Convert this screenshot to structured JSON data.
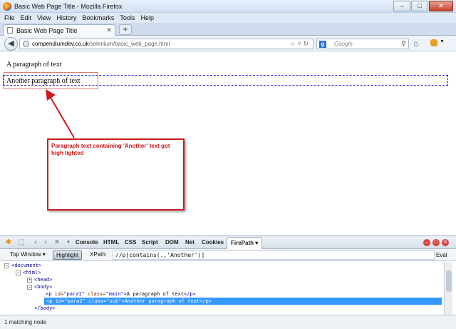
{
  "window": {
    "title": "Basic Web Page Title - Mozilla Firefox",
    "buttons": [
      "–",
      "□",
      "✕"
    ]
  },
  "menubar": {
    "items": [
      "File",
      "Edit",
      "View",
      "History",
      "Bookmarks",
      "Tools",
      "Help"
    ]
  },
  "tabs": {
    "active_title": "Basic Web Page Title",
    "new_tab": "+"
  },
  "navbar": {
    "url_host": "compendiumdev.co.uk",
    "url_path": "/selenium/basic_web_page.html",
    "search_placeholder": "Google",
    "search_engine_letter": "g"
  },
  "page": {
    "para1": "A paragraph of text",
    "para2": "Another paragraph of text",
    "annotation": "Paragraph text containing 'Another' text got high lighted"
  },
  "firebug": {
    "tabs": [
      "Console",
      "HTML",
      "CSS",
      "Script",
      "DOM",
      "Net",
      "Cookies",
      "FirePath ▾"
    ],
    "firepath": {
      "top_window": "Top Window ▾",
      "highlight": "Highlight",
      "xpath_label": "XPath:",
      "xpath_value": "//p[contains(.,'Another')]",
      "eval": "Eval"
    },
    "dom_tree": {
      "document": "<document>",
      "html": "<html>",
      "head": "<head>",
      "body": "<body>",
      "p1": {
        "tag": "p",
        "id": "para1",
        "class": "main",
        "text": "A paragraph of text"
      },
      "p2": {
        "tag": "p",
        "id": "para2",
        "class": "sub",
        "text": "Another paragraph of text"
      },
      "body_close": "</body>"
    },
    "status": "1 matching node"
  }
}
